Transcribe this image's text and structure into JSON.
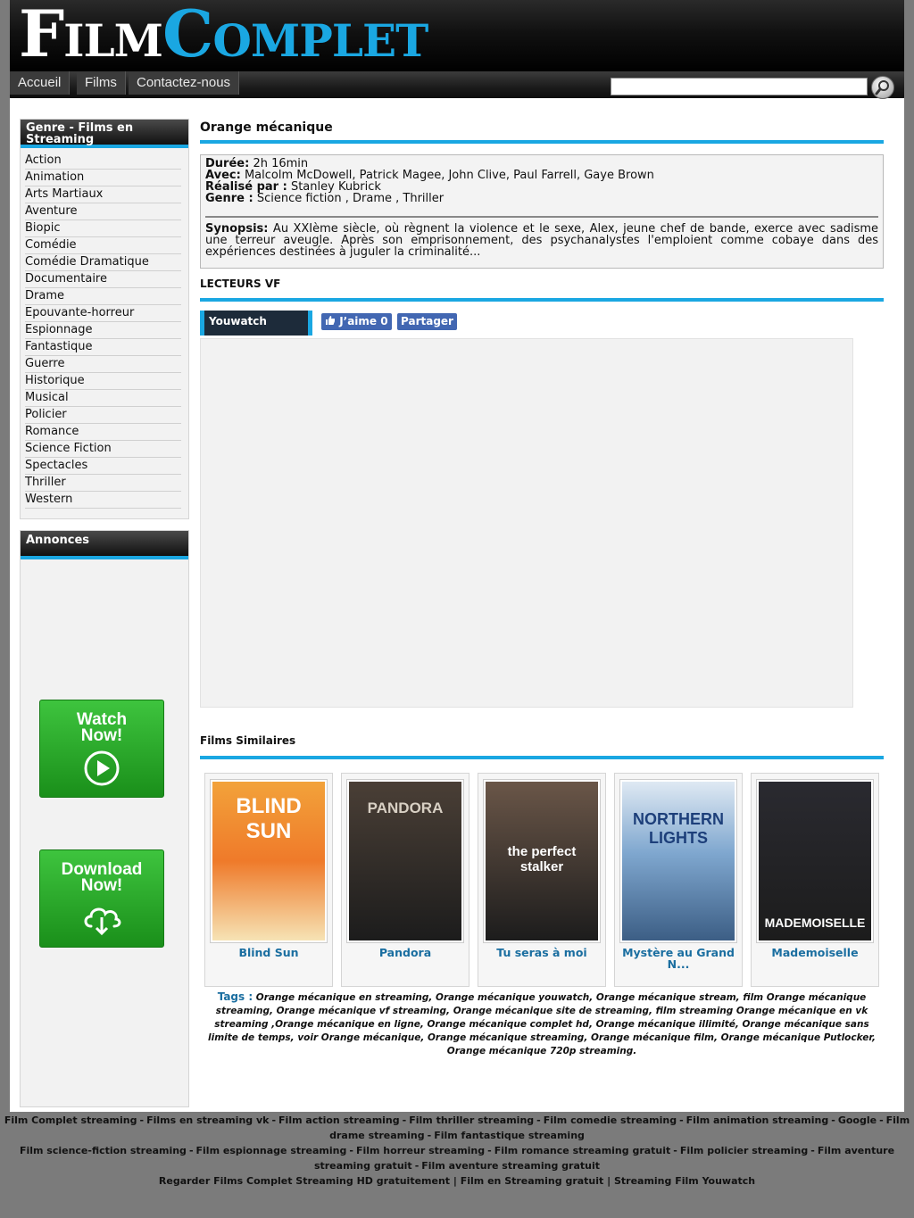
{
  "header": {
    "logo_part1_initial": "F",
    "logo_part1_rest": "ILM",
    "logo_part2_initial": "C",
    "logo_part2_rest": "OMPLET"
  },
  "nav": {
    "items": [
      "Accueil",
      "Films",
      "Contactez-nous"
    ],
    "search_placeholder": ""
  },
  "sidebar": {
    "genres_title": "Genre - Films en Streaming",
    "genres": [
      "Action",
      "Animation",
      "Arts Martiaux",
      "Aventure",
      "Biopic",
      "Comédie",
      "Comédie Dramatique",
      "Documentaire",
      "Drame",
      "Epouvante-horreur",
      "Espionnage",
      "Fantastique",
      "Guerre",
      "Historique",
      "Musical",
      "Policier",
      "Romance",
      "Science Fiction",
      "Spectacles",
      "Thriller",
      "Western"
    ],
    "ads_title": "Annonces",
    "watch_button": [
      "Watch",
      "Now!"
    ],
    "download_button": [
      "Download",
      "Now!"
    ]
  },
  "movie": {
    "title": "Orange mécanique",
    "duree_label": "Durée:",
    "duree": "2h 16min",
    "avec_label": "Avec:",
    "avec": "Malcolm McDowell, Patrick Magee, John Clive, Paul Farrell, Gaye Brown",
    "realise_label": "Réalisé par :",
    "realise": "Stanley Kubrick",
    "genre_label": "Genre :",
    "genre": "Science fiction , Drame , Thriller",
    "synopsis_label": "Synopsis:",
    "synopsis": "Au XXIème siècle, où règnent la violence et le sexe, Alex, jeune chef de bande, exerce avec sadisme une terreur aveugle. Après son emprisonnement, des psychanalystes l'emploient comme cobaye dans des expériences destinées à juguler la criminalité..."
  },
  "player": {
    "section_title": "LECTEURS VF",
    "tab_label": "Youwatch",
    "like_label": "J’aime 0",
    "share_label": "Partager"
  },
  "similar": {
    "section_title": "Films Similaires",
    "movies": [
      {
        "title": "Blind Sun",
        "poster_text": "BLIND SUN",
        "color": "#e8742a"
      },
      {
        "title": "Pandora",
        "poster_text": "PANDORA",
        "color": "#4a3f36"
      },
      {
        "title": "Tu seras à moi",
        "poster_text": "the perfect stalker",
        "color": "#6a5648"
      },
      {
        "title": "Mystère au Grand N...",
        "poster_text": "NORTHERN LIGHTS",
        "color": "#7fa7cf"
      },
      {
        "title": "Mademoiselle",
        "poster_text": "MADEMOISELLE",
        "color": "#2a2a30"
      }
    ]
  },
  "tags": {
    "label": "Tags :",
    "text": "Orange mécanique en streaming, Orange mécanique youwatch, Orange mécanique stream, film Orange mécanique streaming, Orange mécanique vf streaming, Orange mécanique site de streaming, film streaming Orange mécanique en vk streaming ,Orange mécanique en ligne, Orange mécanique complet hd, Orange mécanique illimité, Orange mécanique sans limite de temps, voir Orange mécanique, Orange mécanique streaming, Orange mécanique film, Orange mécanique Putlocker, Orange mécanique 720p streaming."
  },
  "footer": {
    "line1": [
      "Film Complet streaming",
      "Films en streaming vk",
      "Film action streaming",
      "Film thriller streaming",
      "Film comedie streaming",
      "Film animation streaming",
      "Google",
      "Film drame streaming",
      "Film fantastique streaming"
    ],
    "line2": [
      "Film science-fiction streaming",
      "Film espionnage streaming",
      "Film horreur streaming",
      "Film romance streaming gratuit",
      "Film policier streaming",
      "Film aventure streaming gratuit",
      "Film aventure streaming gratuit"
    ],
    "line3": "Regarder Films Complet Streaming HD gratuitement | Film en Streaming gratuit | Streaming Film Youwatch"
  },
  "colors": {
    "accent": "#1aa7e2",
    "background": "#7b7b7b",
    "cta_green": "#2aa82a",
    "facebook": "#4267b2"
  }
}
